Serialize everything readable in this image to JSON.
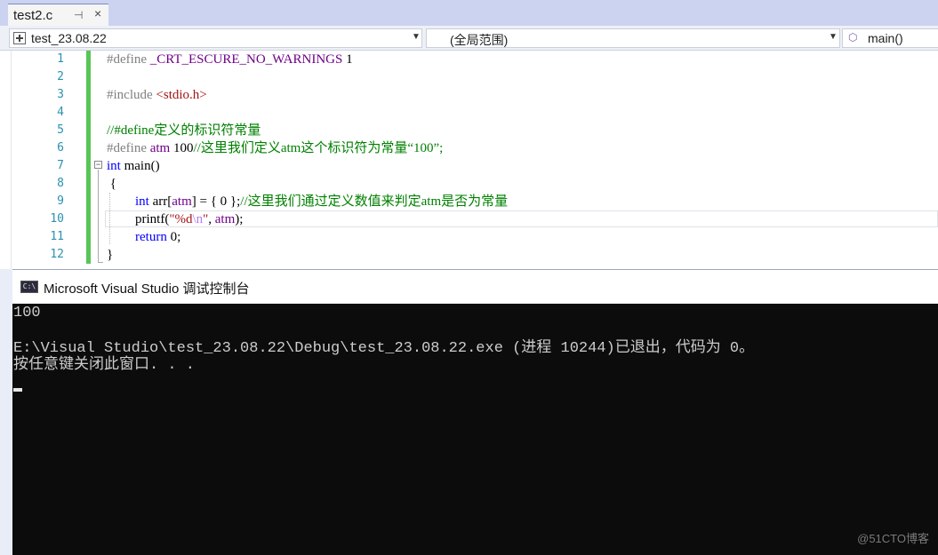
{
  "tab": {
    "label": "test2.c",
    "pin": "⊣",
    "close": "×"
  },
  "nav": {
    "project": "test_23.08.22",
    "scope": "(全局范围)",
    "function": "main()"
  },
  "editor": {
    "lines": [
      {
        "n": "1"
      },
      {
        "n": "2"
      },
      {
        "n": "3"
      },
      {
        "n": "4"
      },
      {
        "n": "5"
      },
      {
        "n": "6"
      },
      {
        "n": "7"
      },
      {
        "n": "8"
      },
      {
        "n": "9"
      },
      {
        "n": "10"
      },
      {
        "n": "11"
      },
      {
        "n": "12"
      }
    ],
    "code": {
      "l1_pre": "#define ",
      "l1_macro": "_CRT_ESCURE_NO_WARNINGS",
      "l1_val": " 1",
      "l3_pre": "#include ",
      "l3_str": "<stdio.h>",
      "l5_com": "//#define定义的标识符常量",
      "l6_pre": "#define ",
      "l6_macro": "atm",
      "l6_val": " 100",
      "l6_com": "//这里我们定义atm这个标识符为常量“100”;",
      "l7_kw": "int",
      "l7_rest": " main()",
      "l8": " {",
      "l9_kw": "int",
      "l9_a": " arr[",
      "l9_macro": "atm",
      "l9_b": "] = { 0 };",
      "l9_com": "//这里我们通过定义数值来判定atm是否为常量",
      "l10_a": "printf(",
      "l10_s1": "\"%d",
      "l10_esc": "\\n",
      "l10_s2": "\"",
      "l10_b": ", ",
      "l10_macro": "atm",
      "l10_c": ");",
      "l11_kw": "return",
      "l11_rest": " 0;",
      "l12": "}"
    }
  },
  "console": {
    "title": "Microsoft Visual Studio 调试控制台",
    "icon_text": "C:\\",
    "lines": [
      "100",
      "",
      "E:\\Visual Studio\\test_23.08.22\\Debug\\test_23.08.22.exe (进程 10244)已退出，代码为 0。",
      "按任意键关闭此窗口. . ."
    ]
  },
  "watermark": "@51CTO博客",
  "colors": {
    "change_bar": "#57c657",
    "line_number": "#2b91af",
    "keyword": "#0000ff",
    "comment": "#008000",
    "macro": "#6f008a",
    "console_bg": "#0c0c0c"
  }
}
